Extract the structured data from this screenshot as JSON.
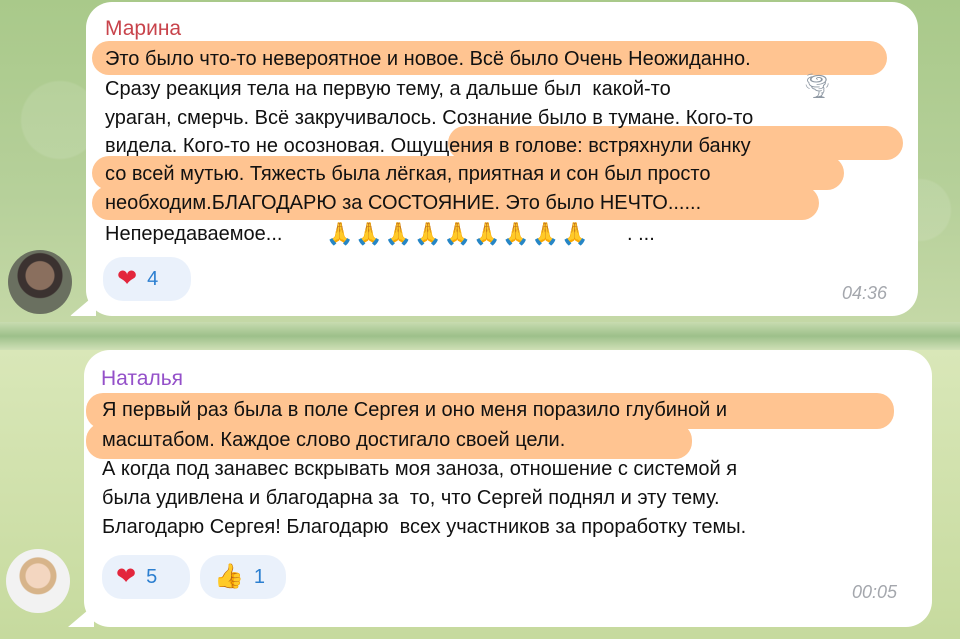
{
  "messages": [
    {
      "sender": "Марина",
      "sender_color": "#c8434b",
      "lines": [
        "Это было что-то невероятное и новое. Всё было Очень Неожиданно.",
        "Сразу реакция тела на первую тему, а дальше был  какой-то",
        "ураган, смерчь. Всё закручивалось. Сознание было в тумане. Кого-то",
        "видела. Кого-то не осозновая. Ощущения в голове: встряхнули банку",
        "со всей мутью. Тяжесть была лёгкая, приятная и сон был просто",
        "необходим.БЛАГОДАРЮ за СОСТОЯНИЕ. Это было НЕЧТО......",
        "Непередаваемое...",
        ". ..."
      ],
      "inline_icon": "tornado-icon",
      "emoji_run": "folded-hands-icon x9",
      "emoji_text": "🙏🙏🙏🙏🙏🙏🙏🙏🙏",
      "reactions": [
        {
          "icon": "heart-icon",
          "glyph": "❤",
          "count": "4"
        }
      ],
      "time": "04:36"
    },
    {
      "sender": "Наталья",
      "sender_color": "#9450c9",
      "lines": [
        "Я первый раз была в поле Сергея и оно меня поразило глубиной и",
        "масштабом. Каждое слово достигало своей цели.",
        "А когда под занавес вскрывать моя заноза, отношение с системой я",
        "была удивлена и благодарна за  то, что Сергей поднял и эту тему.",
        "Благодарю Сергея! Благодарю  всех участников за проработку темы."
      ],
      "reactions": [
        {
          "icon": "heart-icon",
          "glyph": "❤",
          "count": "5"
        },
        {
          "icon": "thumbs-up-icon",
          "glyph": "👍",
          "count": "1"
        }
      ],
      "time": "00:05"
    }
  ],
  "colors": {
    "highlight": "#ffc491",
    "reaction_bg": "#eaf1fb",
    "reaction_count": "#2c7fd0",
    "timestamp": "#a4a7ad"
  }
}
